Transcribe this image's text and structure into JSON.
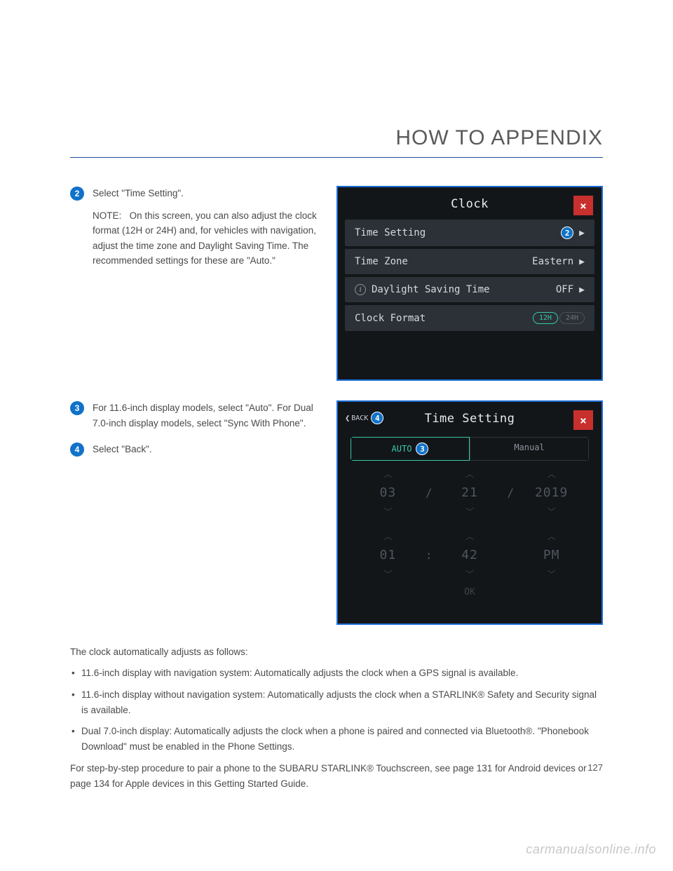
{
  "header": {
    "title": "HOW TO APPENDIX"
  },
  "steps": {
    "s2": {
      "num": "2",
      "text": "Select \"Time Setting\".",
      "note_label": "NOTE:",
      "note_body": "On this screen, you can also adjust the clock format (12H or 24H) and, for vehicles with navigation, adjust the time zone and Daylight Saving Time. The recommended settings for these are \"Auto.\""
    },
    "s3": {
      "num": "3",
      "text": "For 11.6-inch display models, select \"Auto\". For Dual 7.0-inch display models, select \"Sync With Phone\"."
    },
    "s4": {
      "num": "4",
      "text": "Select \"Back\"."
    }
  },
  "screen1": {
    "title": "Clock",
    "close": "×",
    "rows": {
      "time_setting": {
        "label": "Time Setting",
        "callout": "2"
      },
      "time_zone": {
        "label": "Time Zone",
        "value": "Eastern"
      },
      "dst": {
        "label": "Daylight Saving Time",
        "value": "OFF"
      },
      "format": {
        "label": "Clock Format",
        "opt1": "12H",
        "opt2": "24H"
      }
    }
  },
  "screen2": {
    "back": "BACK",
    "back_callout": "4",
    "title": "Time Setting",
    "close": "×",
    "tabs": {
      "auto": "AUTO",
      "auto_callout": "3",
      "manual": "Manual"
    },
    "date": {
      "m": "03",
      "d": "21",
      "y": "2019",
      "sep": "/"
    },
    "time": {
      "h": "01",
      "mn": "42",
      "ap": "PM",
      "sep": ":"
    },
    "ok": "OK"
  },
  "body": {
    "intro": "The clock automatically adjusts as follows:",
    "bullets": [
      "11.6-inch display with navigation system: Automatically adjusts the clock when a GPS signal is available.",
      "11.6-inch display without navigation system: Automatically adjusts the clock when a STARLINK® Safety and Security signal is available.",
      "Dual 7.0-inch display: Automatically adjusts the clock when a phone is paired and connected via Bluetooth®. \"Phonebook Download\" must be enabled in the Phone Settings."
    ],
    "footer": "For step-by-step procedure to pair a phone to the SUBARU STARLINK® Touchscreen, see page 131 for Android devices or page 134 for Apple devices in this Getting Started Guide."
  },
  "page_number": "127",
  "watermark": "carmanualsonline.info"
}
